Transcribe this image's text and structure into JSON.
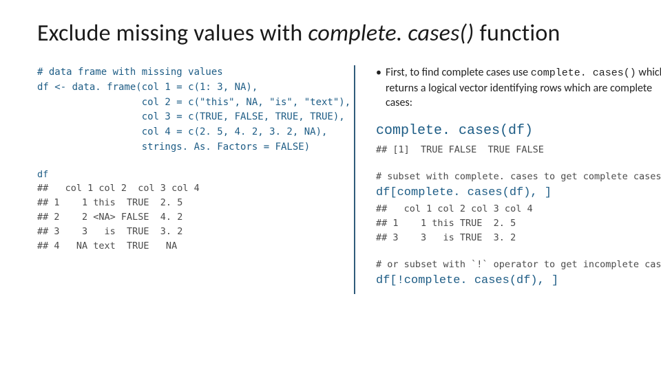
{
  "title": {
    "pre": "Exclude missing values with ",
    "fn": "complete. cases() ",
    "post": "function"
  },
  "left": {
    "comment": "# data frame with missing values",
    "df_create": "df <- data. frame(col 1 = c(1: 3, NA),\n                  col 2 = c(\"this\", NA, \"is\", \"text\"),\n                  col 3 = c(TRUE, FALSE, TRUE, TRUE),\n                  col 4 = c(2. 5, 4. 2, 3. 2, NA),\n                  strings. As. Factors = FALSE)",
    "df_echo": "df",
    "df_table": "##   col 1 col 2  col 3 col 4\n## 1    1 this  TRUE  2. 5\n## 2    2 <NA> FALSE  4. 2\n## 3    3   is  TRUE  3. 2\n## 4   NA text  TRUE   NA"
  },
  "right": {
    "bullet1_a": "First, to find complete cases use ",
    "bullet1_code": "complete. cases()",
    "bullet1_b": " which returns a logical vector identifying rows which are complete cases:",
    "cc_call": "complete. cases(df)",
    "cc_out": "## [1]  TRUE FALSE  TRUE FALSE",
    "subset_comment": "# subset with complete. cases to get complete cases",
    "subset_call": "df[complete. cases(df), ]",
    "subset_out": "##   col 1 col 2 col 3 col 4\n## 1    1 this TRUE  2. 5\n## 3    3   is TRUE  3. 2",
    "inv_comment": "# or subset with `!` operator to get incomplete cases",
    "inv_call": "df[!complete. cases(df), ]"
  }
}
